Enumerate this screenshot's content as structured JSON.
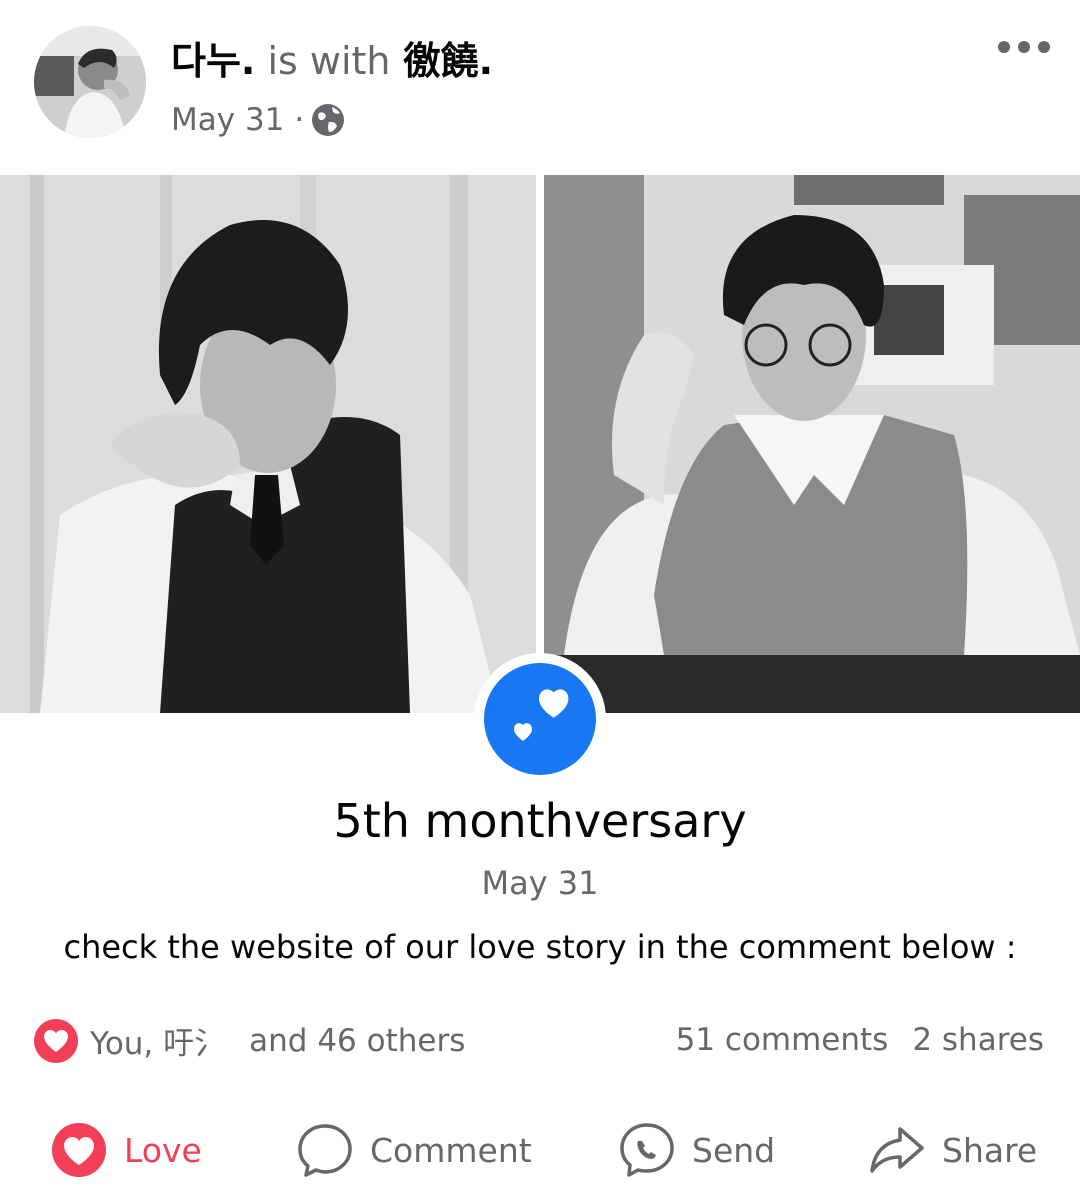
{
  "post": {
    "author": "다누.",
    "with_text": "is with",
    "tagged": "徼饒.",
    "date": "May 31",
    "separator": "·",
    "privacy_icon": "globe-icon"
  },
  "event": {
    "title": "5th monthversary",
    "date": "May 31",
    "icon": "hearts-icon",
    "icon_color": "#1877f2"
  },
  "caption": "check the website of our love story in the comment below :",
  "engagement": {
    "reaction_icon": "love-reaction-icon",
    "reaction_names": "You, 吁氵",
    "reaction_others": "and 46 others",
    "comments": "51 comments",
    "shares": "2 shares"
  },
  "actions": {
    "love": "Love",
    "comment": "Comment",
    "send": "Send",
    "share": "Share"
  },
  "colors": {
    "love": "#f33e58",
    "accent": "#1877f2",
    "secondary_text": "#65676b"
  }
}
